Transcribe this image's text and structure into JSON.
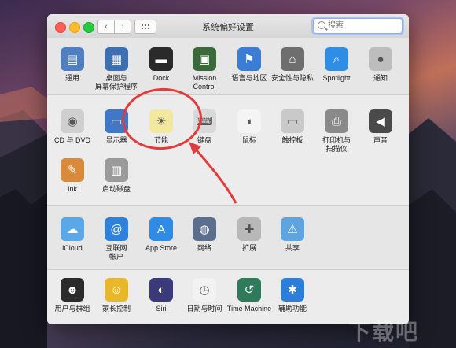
{
  "window": {
    "title": "系统偏好设置"
  },
  "search": {
    "placeholder": "搜索"
  },
  "nav": {
    "back": "‹",
    "forward": "›"
  },
  "sections": [
    {
      "panes": [
        {
          "label": "通用",
          "icon": "general-icon",
          "color": "#4f7fc1"
        },
        {
          "label": "桌面与\n屏幕保护程序",
          "icon": "desktop-screensaver-icon",
          "color": "#3d6fb3"
        },
        {
          "label": "Dock",
          "icon": "dock-icon",
          "color": "#2a2a2a"
        },
        {
          "label": "Mission\nControl",
          "icon": "mission-control-icon",
          "color": "#3a6a3a"
        },
        {
          "label": "语言与地区",
          "icon": "language-region-icon",
          "color": "#3b7cd4"
        },
        {
          "label": "安全性与隐私",
          "icon": "security-privacy-icon",
          "color": "#6e6e6e"
        },
        {
          "label": "Spotlight",
          "icon": "spotlight-icon",
          "color": "#2f8de4"
        },
        {
          "label": "通知",
          "icon": "notifications-icon",
          "color": "#bdbdbd"
        }
      ]
    },
    {
      "panes": [
        {
          "label": "CD 与 DVD",
          "icon": "cd-dvd-icon",
          "color": "#cfcfcf"
        },
        {
          "label": "显示器",
          "icon": "displays-icon",
          "color": "#3f78c8"
        },
        {
          "label": "节能",
          "icon": "energy-saver-icon",
          "color": "#f3e8a0"
        },
        {
          "label": "键盘",
          "icon": "keyboard-icon",
          "color": "#d9d9d9"
        },
        {
          "label": "鼠标",
          "icon": "mouse-icon",
          "color": "#f4f4f4"
        },
        {
          "label": "触控板",
          "icon": "trackpad-icon",
          "color": "#c9c9c9"
        },
        {
          "label": "打印机与\n扫描仪",
          "icon": "printers-scanners-icon",
          "color": "#8a8a8a"
        },
        {
          "label": "声音",
          "icon": "sound-icon",
          "color": "#4a4a4a"
        },
        {
          "label": "Ink",
          "icon": "ink-icon",
          "color": "#d98a3a"
        },
        {
          "label": "启动磁盘",
          "icon": "startup-disk-icon",
          "color": "#9a9a9a"
        }
      ]
    },
    {
      "panes": [
        {
          "label": "iCloud",
          "icon": "icloud-icon",
          "color": "#5aa7ea"
        },
        {
          "label": "互联网\n帐户",
          "icon": "internet-accounts-icon",
          "color": "#2e82dc"
        },
        {
          "label": "App Store",
          "icon": "app-store-icon",
          "color": "#2f8be6"
        },
        {
          "label": "网络",
          "icon": "network-icon",
          "color": "#5b6e8e"
        },
        {
          "label": "扩展",
          "icon": "extensions-icon",
          "color": "#b8b8b8"
        },
        {
          "label": "共享",
          "icon": "sharing-icon",
          "color": "#5da4e0"
        }
      ]
    },
    {
      "panes": [
        {
          "label": "用户与群组",
          "icon": "users-groups-icon",
          "color": "#2b2b2b"
        },
        {
          "label": "家长控制",
          "icon": "parental-controls-icon",
          "color": "#e8b82a"
        },
        {
          "label": "Siri",
          "icon": "siri-icon",
          "color": "#3a3a7a"
        },
        {
          "label": "日期与时间",
          "icon": "date-time-icon",
          "color": "#f2f2f2"
        },
        {
          "label": "Time Machine",
          "icon": "time-machine-icon",
          "color": "#2f7a5a"
        },
        {
          "label": "辅助功能",
          "icon": "accessibility-icon",
          "color": "#2c7fd8"
        }
      ]
    }
  ],
  "annotation": {
    "color": "#e23b3b"
  },
  "watermark": "下载吧"
}
